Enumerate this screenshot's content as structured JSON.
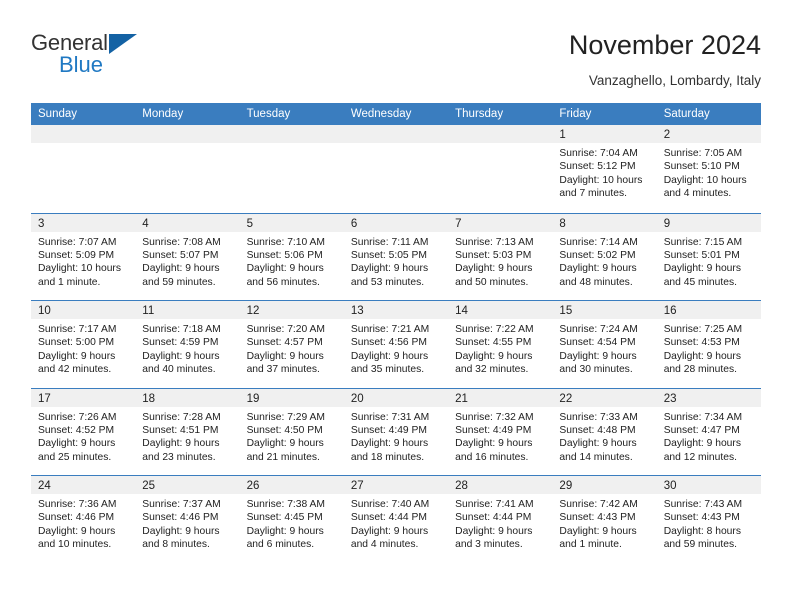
{
  "brand": {
    "name_top": "General",
    "name_bottom": "Blue",
    "accent_color": "#2079c3",
    "triangle_color": "#1462a4"
  },
  "header": {
    "title": "November 2024",
    "subtitle": "Vanzaghello, Lombardy, Italy"
  },
  "theme": {
    "header_row_bg": "#3a7dbf",
    "daynum_band_bg": "#f0f0f0",
    "cell_border": "#3a7dbf",
    "text": "#222222"
  },
  "weekdays": [
    "Sunday",
    "Monday",
    "Tuesday",
    "Wednesday",
    "Thursday",
    "Friday",
    "Saturday"
  ],
  "weeks": [
    [
      {
        "day": "",
        "empty": true
      },
      {
        "day": "",
        "empty": true
      },
      {
        "day": "",
        "empty": true
      },
      {
        "day": "",
        "empty": true
      },
      {
        "day": "",
        "empty": true
      },
      {
        "day": "1",
        "sunrise": "Sunrise: 7:04 AM",
        "sunset": "Sunset: 5:12 PM",
        "daylight1": "Daylight: 10 hours",
        "daylight2": "and 7 minutes."
      },
      {
        "day": "2",
        "sunrise": "Sunrise: 7:05 AM",
        "sunset": "Sunset: 5:10 PM",
        "daylight1": "Daylight: 10 hours",
        "daylight2": "and 4 minutes."
      }
    ],
    [
      {
        "day": "3",
        "sunrise": "Sunrise: 7:07 AM",
        "sunset": "Sunset: 5:09 PM",
        "daylight1": "Daylight: 10 hours",
        "daylight2": "and 1 minute."
      },
      {
        "day": "4",
        "sunrise": "Sunrise: 7:08 AM",
        "sunset": "Sunset: 5:07 PM",
        "daylight1": "Daylight: 9 hours",
        "daylight2": "and 59 minutes."
      },
      {
        "day": "5",
        "sunrise": "Sunrise: 7:10 AM",
        "sunset": "Sunset: 5:06 PM",
        "daylight1": "Daylight: 9 hours",
        "daylight2": "and 56 minutes."
      },
      {
        "day": "6",
        "sunrise": "Sunrise: 7:11 AM",
        "sunset": "Sunset: 5:05 PM",
        "daylight1": "Daylight: 9 hours",
        "daylight2": "and 53 minutes."
      },
      {
        "day": "7",
        "sunrise": "Sunrise: 7:13 AM",
        "sunset": "Sunset: 5:03 PM",
        "daylight1": "Daylight: 9 hours",
        "daylight2": "and 50 minutes."
      },
      {
        "day": "8",
        "sunrise": "Sunrise: 7:14 AM",
        "sunset": "Sunset: 5:02 PM",
        "daylight1": "Daylight: 9 hours",
        "daylight2": "and 48 minutes."
      },
      {
        "day": "9",
        "sunrise": "Sunrise: 7:15 AM",
        "sunset": "Sunset: 5:01 PM",
        "daylight1": "Daylight: 9 hours",
        "daylight2": "and 45 minutes."
      }
    ],
    [
      {
        "day": "10",
        "sunrise": "Sunrise: 7:17 AM",
        "sunset": "Sunset: 5:00 PM",
        "daylight1": "Daylight: 9 hours",
        "daylight2": "and 42 minutes."
      },
      {
        "day": "11",
        "sunrise": "Sunrise: 7:18 AM",
        "sunset": "Sunset: 4:59 PM",
        "daylight1": "Daylight: 9 hours",
        "daylight2": "and 40 minutes."
      },
      {
        "day": "12",
        "sunrise": "Sunrise: 7:20 AM",
        "sunset": "Sunset: 4:57 PM",
        "daylight1": "Daylight: 9 hours",
        "daylight2": "and 37 minutes."
      },
      {
        "day": "13",
        "sunrise": "Sunrise: 7:21 AM",
        "sunset": "Sunset: 4:56 PM",
        "daylight1": "Daylight: 9 hours",
        "daylight2": "and 35 minutes."
      },
      {
        "day": "14",
        "sunrise": "Sunrise: 7:22 AM",
        "sunset": "Sunset: 4:55 PM",
        "daylight1": "Daylight: 9 hours",
        "daylight2": "and 32 minutes."
      },
      {
        "day": "15",
        "sunrise": "Sunrise: 7:24 AM",
        "sunset": "Sunset: 4:54 PM",
        "daylight1": "Daylight: 9 hours",
        "daylight2": "and 30 minutes."
      },
      {
        "day": "16",
        "sunrise": "Sunrise: 7:25 AM",
        "sunset": "Sunset: 4:53 PM",
        "daylight1": "Daylight: 9 hours",
        "daylight2": "and 28 minutes."
      }
    ],
    [
      {
        "day": "17",
        "sunrise": "Sunrise: 7:26 AM",
        "sunset": "Sunset: 4:52 PM",
        "daylight1": "Daylight: 9 hours",
        "daylight2": "and 25 minutes."
      },
      {
        "day": "18",
        "sunrise": "Sunrise: 7:28 AM",
        "sunset": "Sunset: 4:51 PM",
        "daylight1": "Daylight: 9 hours",
        "daylight2": "and 23 minutes."
      },
      {
        "day": "19",
        "sunrise": "Sunrise: 7:29 AM",
        "sunset": "Sunset: 4:50 PM",
        "daylight1": "Daylight: 9 hours",
        "daylight2": "and 21 minutes."
      },
      {
        "day": "20",
        "sunrise": "Sunrise: 7:31 AM",
        "sunset": "Sunset: 4:49 PM",
        "daylight1": "Daylight: 9 hours",
        "daylight2": "and 18 minutes."
      },
      {
        "day": "21",
        "sunrise": "Sunrise: 7:32 AM",
        "sunset": "Sunset: 4:49 PM",
        "daylight1": "Daylight: 9 hours",
        "daylight2": "and 16 minutes."
      },
      {
        "day": "22",
        "sunrise": "Sunrise: 7:33 AM",
        "sunset": "Sunset: 4:48 PM",
        "daylight1": "Daylight: 9 hours",
        "daylight2": "and 14 minutes."
      },
      {
        "day": "23",
        "sunrise": "Sunrise: 7:34 AM",
        "sunset": "Sunset: 4:47 PM",
        "daylight1": "Daylight: 9 hours",
        "daylight2": "and 12 minutes."
      }
    ],
    [
      {
        "day": "24",
        "sunrise": "Sunrise: 7:36 AM",
        "sunset": "Sunset: 4:46 PM",
        "daylight1": "Daylight: 9 hours",
        "daylight2": "and 10 minutes."
      },
      {
        "day": "25",
        "sunrise": "Sunrise: 7:37 AM",
        "sunset": "Sunset: 4:46 PM",
        "daylight1": "Daylight: 9 hours",
        "daylight2": "and 8 minutes."
      },
      {
        "day": "26",
        "sunrise": "Sunrise: 7:38 AM",
        "sunset": "Sunset: 4:45 PM",
        "daylight1": "Daylight: 9 hours",
        "daylight2": "and 6 minutes."
      },
      {
        "day": "27",
        "sunrise": "Sunrise: 7:40 AM",
        "sunset": "Sunset: 4:44 PM",
        "daylight1": "Daylight: 9 hours",
        "daylight2": "and 4 minutes."
      },
      {
        "day": "28",
        "sunrise": "Sunrise: 7:41 AM",
        "sunset": "Sunset: 4:44 PM",
        "daylight1": "Daylight: 9 hours",
        "daylight2": "and 3 minutes."
      },
      {
        "day": "29",
        "sunrise": "Sunrise: 7:42 AM",
        "sunset": "Sunset: 4:43 PM",
        "daylight1": "Daylight: 9 hours",
        "daylight2": "and 1 minute."
      },
      {
        "day": "30",
        "sunrise": "Sunrise: 7:43 AM",
        "sunset": "Sunset: 4:43 PM",
        "daylight1": "Daylight: 8 hours",
        "daylight2": "and 59 minutes."
      }
    ]
  ]
}
